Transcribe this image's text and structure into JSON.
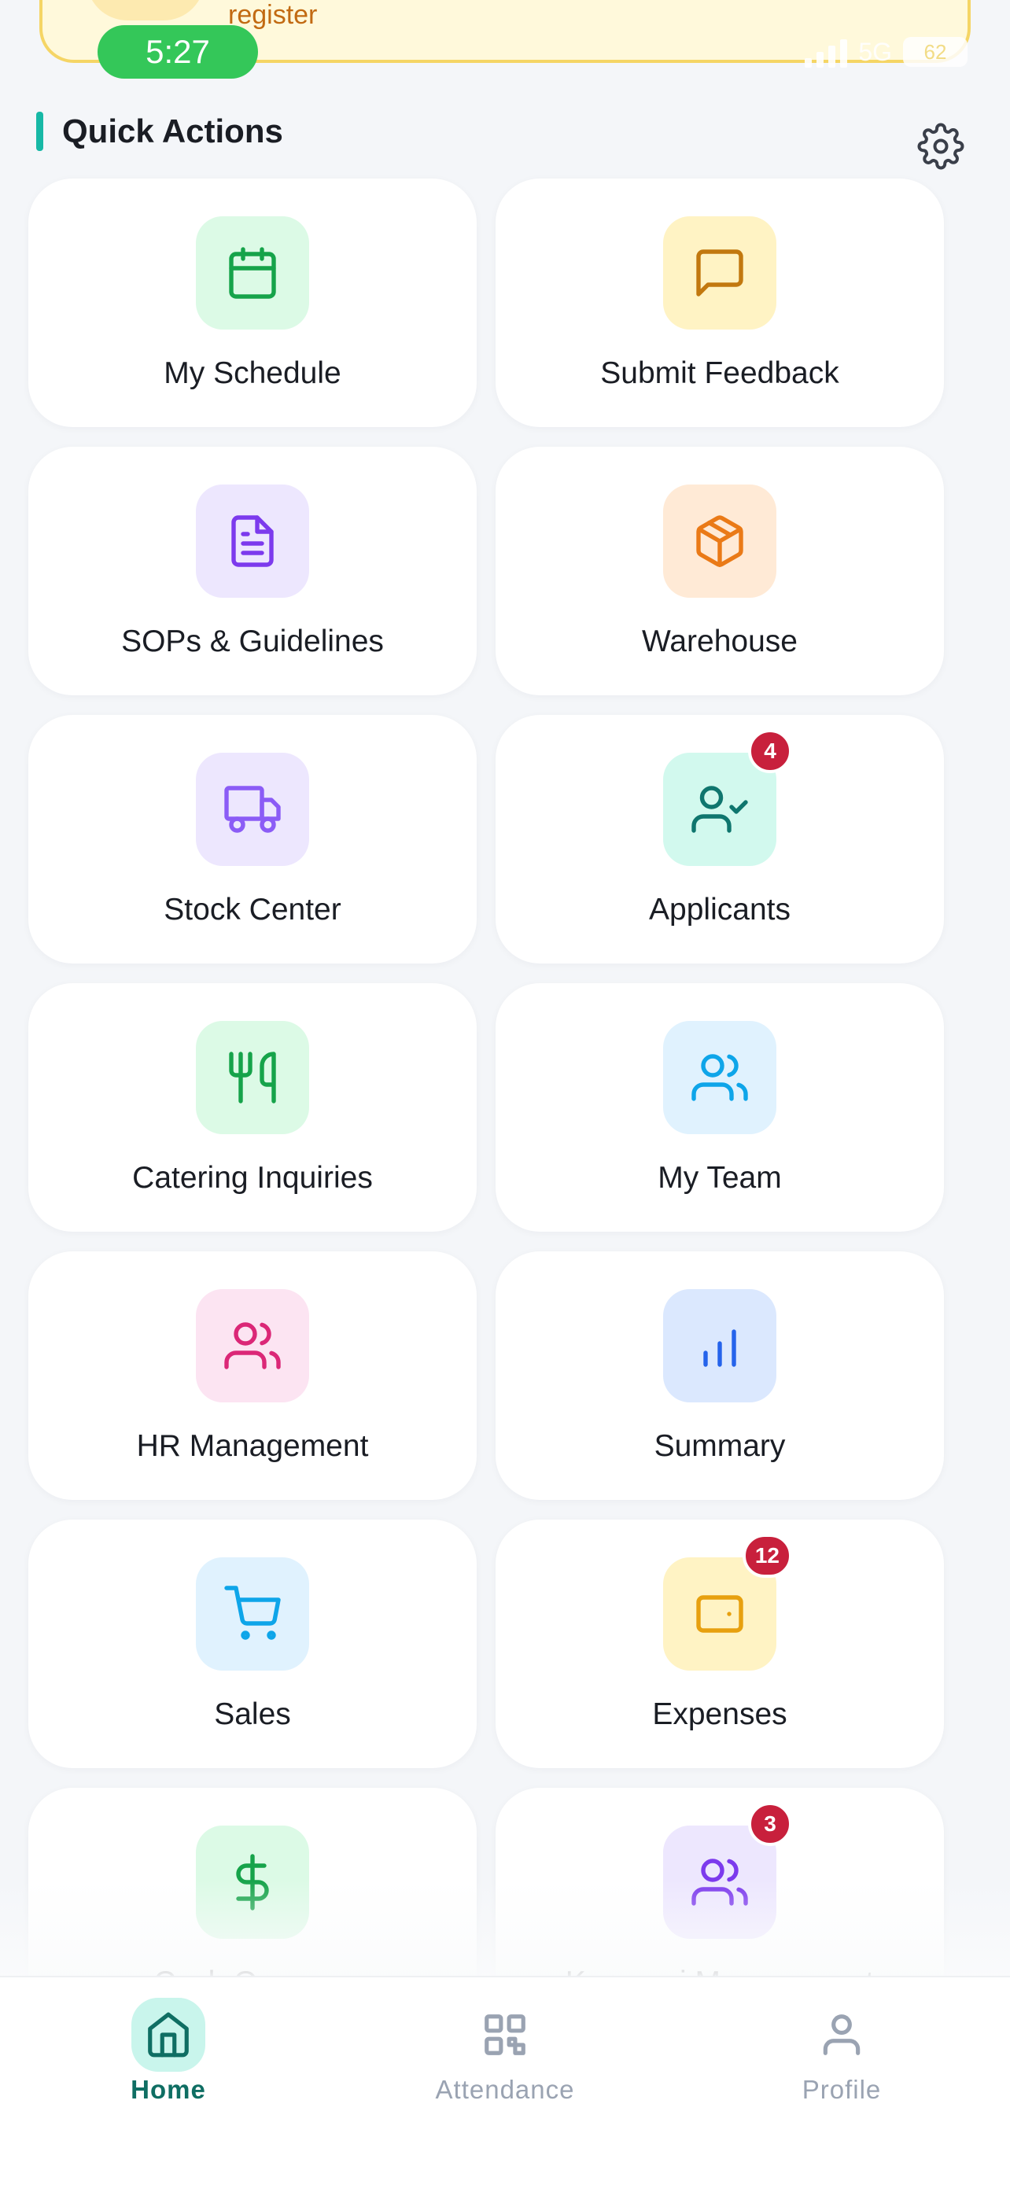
{
  "status_bar": {
    "time": "5:27",
    "network": "5G",
    "battery": "62"
  },
  "banner": {
    "text": "register"
  },
  "quick_actions": {
    "title": "Quick Actions",
    "items": [
      {
        "label": "My Schedule",
        "icon": "calendar-icon",
        "tile_color": "#dcfae6",
        "icon_color": "#16a34a",
        "badge": ""
      },
      {
        "label": "Submit Feedback",
        "icon": "message-square-icon",
        "tile_color": "#fff3c4",
        "icon_color": "#c2780f",
        "badge": ""
      },
      {
        "label": "SOPs & Guidelines",
        "icon": "file-text-icon",
        "tile_color": "#ede7fe",
        "icon_color": "#7c3aed",
        "badge": ""
      },
      {
        "label": "Warehouse",
        "icon": "package-icon",
        "tile_color": "#ffead6",
        "icon_color": "#ea7a17",
        "badge": ""
      },
      {
        "label": "Stock Center",
        "icon": "truck-icon",
        "tile_color": "#ede7fe",
        "icon_color": "#8b5cf6",
        "badge": ""
      },
      {
        "label": "Applicants",
        "icon": "user-check-icon",
        "tile_color": "#d2f9ee",
        "icon_color": "#0f766e",
        "badge": "4"
      },
      {
        "label": "Catering Inquiries",
        "icon": "utensils-icon",
        "tile_color": "#dcfae6",
        "icon_color": "#16a34a",
        "badge": ""
      },
      {
        "label": "My Team",
        "icon": "users-icon",
        "tile_color": "#e0f2fe",
        "icon_color": "#0ea5e9",
        "badge": ""
      },
      {
        "label": "HR Management",
        "icon": "users-icon",
        "tile_color": "#fce4f2",
        "icon_color": "#db2777",
        "badge": ""
      },
      {
        "label": "Summary",
        "icon": "bar-chart-icon",
        "tile_color": "#dbe8fe",
        "icon_color": "#2563eb",
        "badge": ""
      },
      {
        "label": "Sales",
        "icon": "shopping-cart-icon",
        "tile_color": "#e0f2fe",
        "icon_color": "#0ea5e9",
        "badge": ""
      },
      {
        "label": "Expenses",
        "icon": "wallet-icon",
        "tile_color": "#fff3c4",
        "icon_color": "#e7a00f",
        "badge": "12"
      },
      {
        "label": "Cash Opname",
        "icon": "dollar-sign-icon",
        "tile_color": "#dcfae6",
        "icon_color": "#16a34a",
        "badge": ""
      },
      {
        "label": "Koperasi Management",
        "icon": "users-icon",
        "tile_color": "#ede7fe",
        "icon_color": "#7c3aed",
        "badge": "3"
      }
    ]
  },
  "bottom_nav": {
    "items": [
      {
        "label": "Home",
        "icon": "home-icon",
        "active": true
      },
      {
        "label": "Attendance",
        "icon": "qr-code-icon",
        "active": false
      },
      {
        "label": "Profile",
        "icon": "user-icon",
        "active": false
      }
    ]
  },
  "colors": {
    "accent": "#17b8a6",
    "badge": "#c8203c",
    "nav_active": "#0f6e63",
    "nav_inactive": "#9aa3b2"
  }
}
